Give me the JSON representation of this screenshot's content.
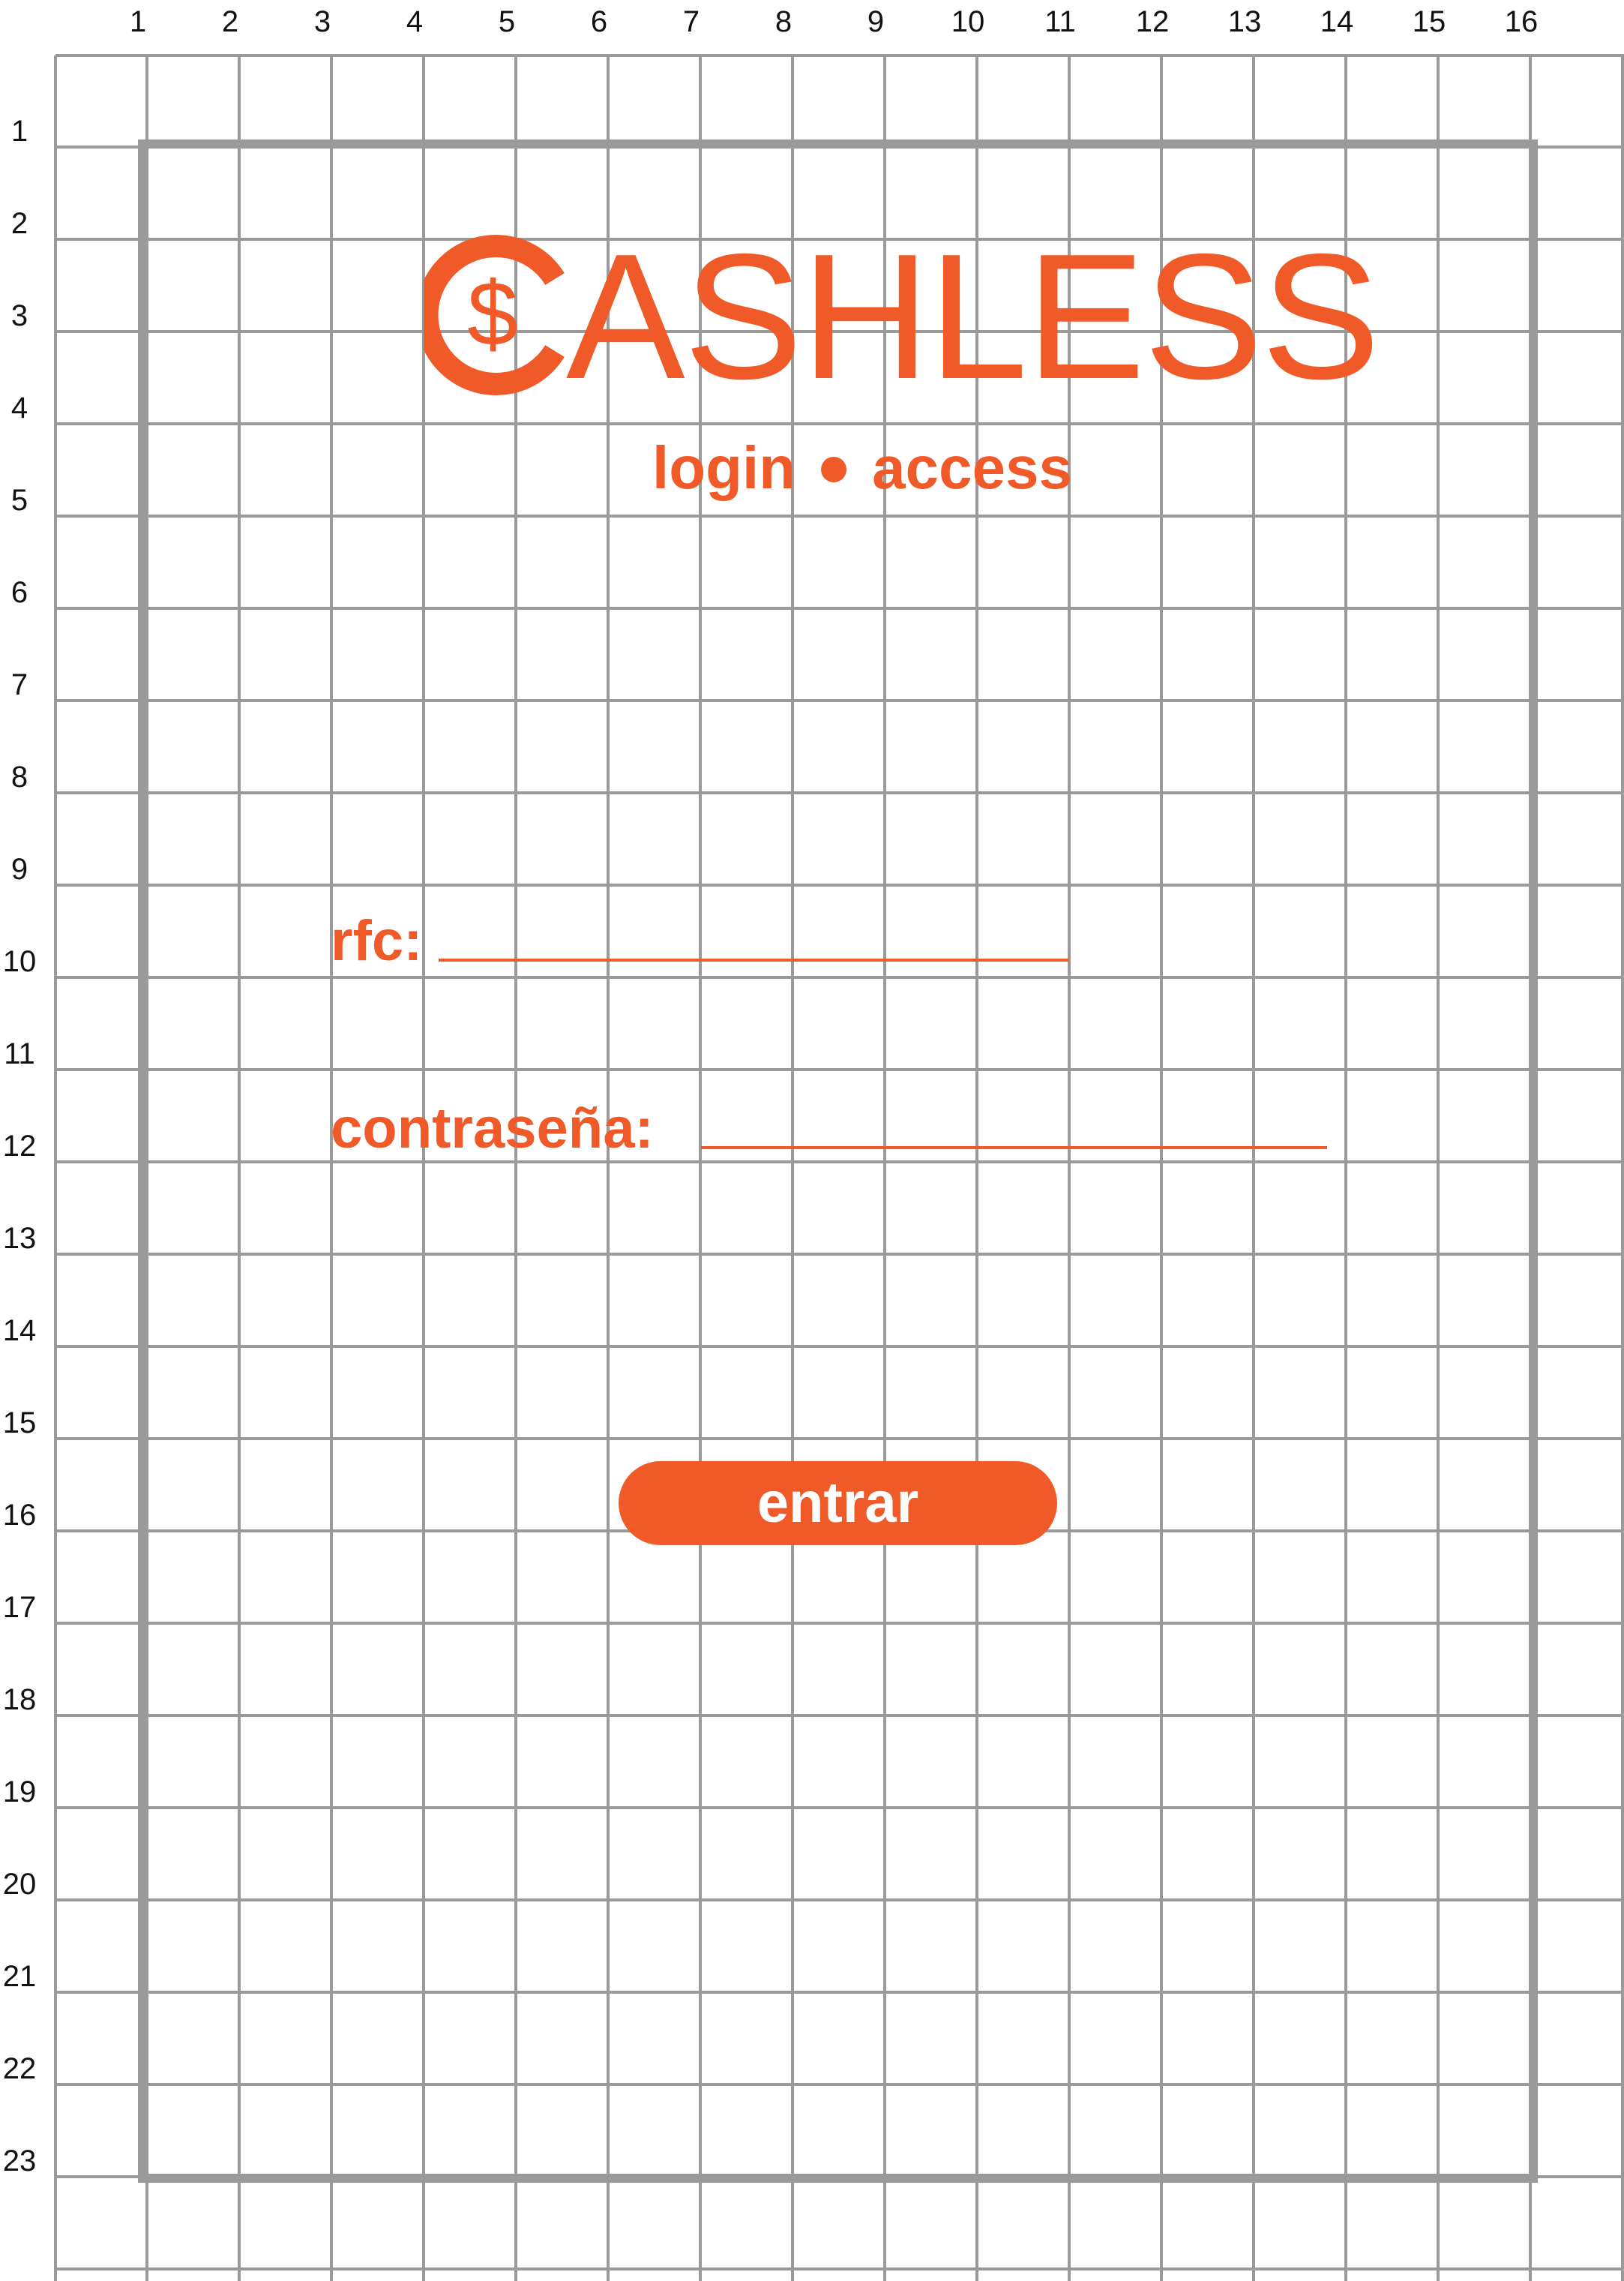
{
  "grid": {
    "column_numbers": [
      "1",
      "2",
      "3",
      "4",
      "5",
      "6",
      "7",
      "8",
      "9",
      "10",
      "11",
      "12",
      "13",
      "14",
      "15",
      "16"
    ],
    "row_numbers": [
      "1",
      "2",
      "3",
      "4",
      "5",
      "6",
      "7",
      "8",
      "9",
      "10",
      "11",
      "12",
      "13",
      "14",
      "15",
      "16",
      "17",
      "18",
      "19",
      "20",
      "21",
      "22",
      "23"
    ],
    "line_color": "#9a9a9a",
    "frame_color": "#9a9a9a"
  },
  "brand": {
    "logo_icon": "dollar-c-icon",
    "name": "ASHLESS",
    "tagline_left": "login",
    "tagline_right": "access",
    "color": "#F05A28"
  },
  "form": {
    "rfc_label": "rfc:",
    "password_label": "contraseña:",
    "rfc_value": "",
    "password_value": ""
  },
  "button": {
    "label": "entrar",
    "color": "#F05A28"
  }
}
